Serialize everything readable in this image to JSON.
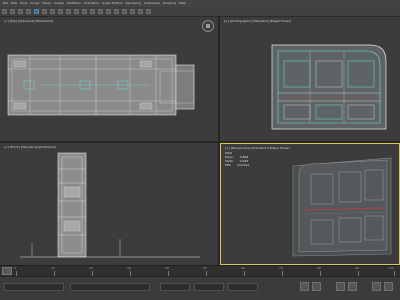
{
  "menubar": {
    "items": [
      "File",
      "Edit",
      "Tools",
      "Group",
      "Views",
      "Create",
      "Modifiers",
      "Animation",
      "Graph Editors",
      "Rendering",
      "Customize",
      "Scripting",
      "Help"
    ]
  },
  "viewports": {
    "top": {
      "label": "[+] [Top] [Standard] [Wireframe]"
    },
    "perspective_top": {
      "label": "[+] [Orthographic] [Standard] [Edged Faces]"
    },
    "front": {
      "label": "[+] [Front] [Standard] [Wireframe]"
    },
    "perspective_bottom": {
      "label": "[+] [Perspective] [Standard] [Edged Faces]",
      "stats": {
        "total_label": "Total",
        "polys_label": "Polys:",
        "polys_value": "2,848",
        "verts_label": "Verts:",
        "verts_value": "2,936",
        "fps_label": "FPS:",
        "fps_value": "Inactive"
      }
    }
  },
  "timeline": {
    "ticks": [
      "0",
      "10",
      "20",
      "30",
      "40",
      "50",
      "60",
      "70",
      "80",
      "90",
      "100"
    ]
  },
  "colors": {
    "active_viewport_border": "#d9c35a",
    "wire_white": "#e6e6e6",
    "wire_cyan": "#6fe0d0",
    "mesh_grey": "#8c8c8c"
  }
}
